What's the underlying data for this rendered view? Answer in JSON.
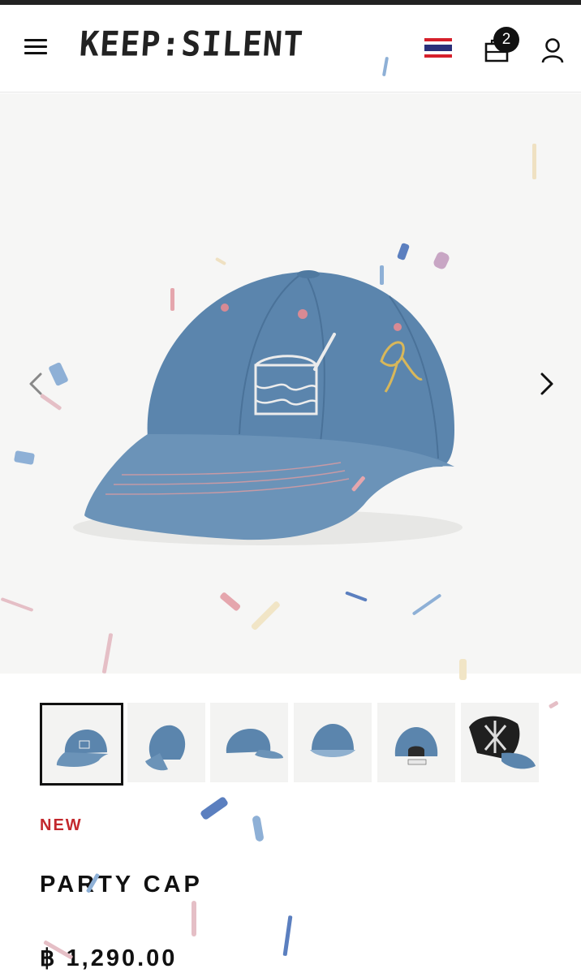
{
  "header": {
    "logo_text": "KEEP:SILENT",
    "cart_count": "2",
    "flag": "thailand-flag"
  },
  "product": {
    "badge": "NEW",
    "name": "PARTY CAP",
    "price": "฿ 1,290.00",
    "image_count": 6,
    "selected_image": 1
  },
  "colors": {
    "badge_red": "#c3282d",
    "cap_blue": "#5b85ad",
    "text_dark": "#111111"
  },
  "icons": {
    "menu": "hamburger-menu-icon",
    "cart": "shopping-bag-icon",
    "account": "user-icon",
    "prev": "chevron-left-icon",
    "next": "chevron-right-icon"
  }
}
